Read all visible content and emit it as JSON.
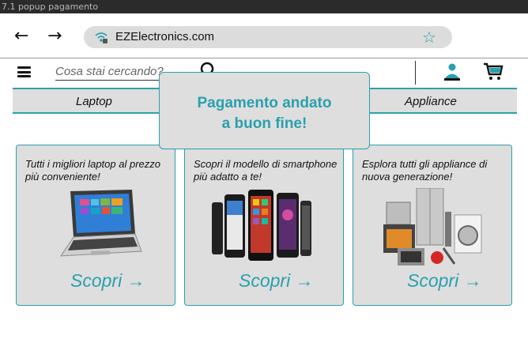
{
  "frame": {
    "label": "7.1 popup pagamento"
  },
  "browser": {
    "back_glyph": "←",
    "forward_glyph": "→",
    "url": "EZElectronics.com",
    "star_glyph": "☆"
  },
  "toolbar": {
    "search_placeholder": "Cosa stai cercando?"
  },
  "categories": [
    "Laptop",
    "Appliance"
  ],
  "cards": [
    {
      "text": "Tutti i migliori laptop al prezzo più conveniente!",
      "cta": "Scopri →"
    },
    {
      "text": "Scopri il modello di smartphone più adatto a te!",
      "cta": "Scopri →"
    },
    {
      "text": "Esplora tutti gli appliance di nuova generazione!",
      "cta": "Scopri →"
    }
  ],
  "popup": {
    "line1": "Pagamento andato",
    "line2": "a buon fine!"
  },
  "colors": {
    "accent": "#2aa0ad",
    "panel": "#dedede"
  }
}
